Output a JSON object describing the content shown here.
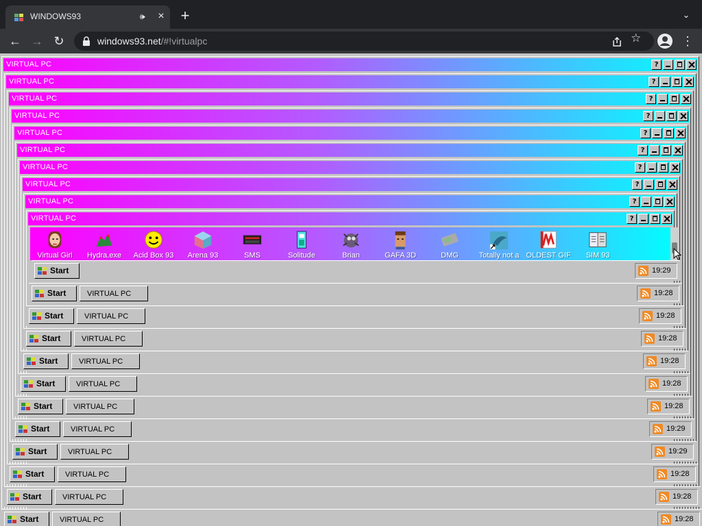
{
  "browser": {
    "tab_title": "WINDOWS93",
    "url_host": "windows93.net",
    "url_path": "/#!virtualpc",
    "tab_audio_icon": "speaker-icon",
    "tab_close_icon": "close-icon",
    "new_tab_icon": "plus-icon"
  },
  "windows": [
    {
      "title": "VIRTUAL PC"
    },
    {
      "title": "VIRTUAL PC"
    },
    {
      "title": "VIRTUAL PC"
    },
    {
      "title": "VIRTUAL PC"
    },
    {
      "title": "VIRTUAL PC"
    },
    {
      "title": "VIRTUAL PC"
    },
    {
      "title": "VIRTUAL PC"
    },
    {
      "title": "VIRTUAL PC"
    },
    {
      "title": "VIRTUAL PC"
    },
    {
      "title": "VIRTUAL PC"
    }
  ],
  "title_buttons": {
    "help": "?"
  },
  "desktop_icons": [
    {
      "label": "Virtual Girl",
      "icon": "virtual-girl-icon"
    },
    {
      "label": "Hydra.exe",
      "icon": "hydra-icon"
    },
    {
      "label": "Acid Box 93",
      "icon": "acid-box-icon"
    },
    {
      "label": "Arena 93",
      "icon": "arena-icon"
    },
    {
      "label": "SMS",
      "icon": "sms-icon"
    },
    {
      "label": "Solitude",
      "icon": "solitude-icon"
    },
    {
      "label": "Brian",
      "icon": "brian-icon"
    },
    {
      "label": "GAFA 3D",
      "icon": "gafa-icon"
    },
    {
      "label": "DMG",
      "icon": "dmg-icon"
    },
    {
      "label": "Totally not a",
      "icon": "dolphin-icon"
    },
    {
      "label": "OLDEST GIF",
      "icon": "oldest-gif-icon"
    },
    {
      "label": "SIM 93",
      "icon": "sim93-icon"
    }
  ],
  "taskbars": [
    {
      "start": "Start",
      "task": "",
      "time": "19:29"
    },
    {
      "start": "Start",
      "task": "VIRTUAL PC",
      "time": "19:28"
    },
    {
      "start": "Start",
      "task": "VIRTUAL PC",
      "time": "19:28"
    },
    {
      "start": "Start",
      "task": "VIRTUAL PC",
      "time": "19:28"
    },
    {
      "start": "Start",
      "task": "VIRTUAL PC",
      "time": "19:28"
    },
    {
      "start": "Start",
      "task": "VIRTUAL PC",
      "time": "19:28"
    },
    {
      "start": "Start",
      "task": "VIRTUAL PC",
      "time": "19:28"
    },
    {
      "start": "Start",
      "task": "VIRTUAL PC",
      "time": "19:29"
    },
    {
      "start": "Start",
      "task": "VIRTUAL PC",
      "time": "19:29"
    },
    {
      "start": "Start",
      "task": "VIRTUAL PC",
      "time": "19:28"
    },
    {
      "start": "Start",
      "task": "VIRTUAL PC",
      "time": "19:28"
    },
    {
      "start": "Start",
      "task": "VIRTUAL PC",
      "time": "19:28"
    }
  ],
  "colors": {
    "title_gradient_start": "#ff00ff",
    "title_gradient_end": "#00ffff",
    "win95_gray": "#c3c3c3",
    "browser_dark": "#202124"
  }
}
